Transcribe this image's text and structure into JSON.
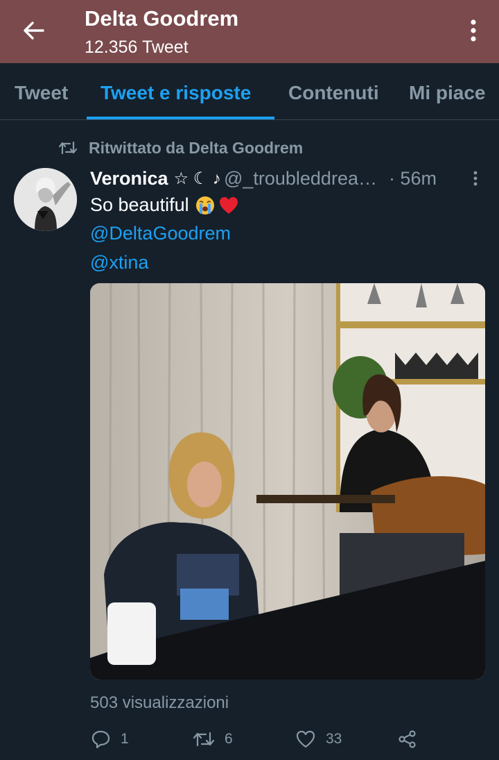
{
  "header": {
    "back_icon": "arrow-left-icon",
    "title": "Delta Goodrem",
    "subtitle": "12.356 Tweet",
    "more_icon": "more-vertical-icon"
  },
  "tabs": [
    {
      "label": "Tweet",
      "active": false
    },
    {
      "label": "Tweet e risposte",
      "active": true
    },
    {
      "label": "Contenuti",
      "active": false
    },
    {
      "label": "Mi piace",
      "active": false
    }
  ],
  "tweet": {
    "retweeted_by": "Ritwittato da Delta Goodrem",
    "author_name": "Veronica",
    "author_badges": "☆ ☾ ♪",
    "handle": "@_troubleddreamer",
    "time": "· 56m",
    "text": "So beautiful",
    "emoji": [
      "loudly-crying-face",
      "red-heart"
    ],
    "mentions": [
      "@DeltaGoodrem",
      "@xtina"
    ],
    "views": "503 visualizzazioni",
    "replies": "1",
    "retweets": "6",
    "likes": "33"
  },
  "colors": {
    "appbar": "#7a4a4c",
    "background": "#15202b",
    "accent": "#1da1f2",
    "muted": "#8899a6"
  }
}
